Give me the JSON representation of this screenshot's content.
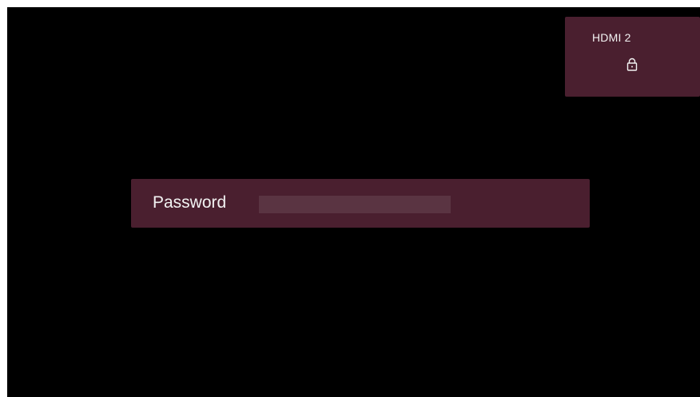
{
  "source_card": {
    "name": "HDMI 2",
    "icon": "lock-icon"
  },
  "password_prompt": {
    "label": "Password",
    "value": ""
  },
  "colors": {
    "background": "#000000",
    "panel": "#4a1f2f",
    "field": "#5a3442",
    "text": "#f2f2f2"
  }
}
